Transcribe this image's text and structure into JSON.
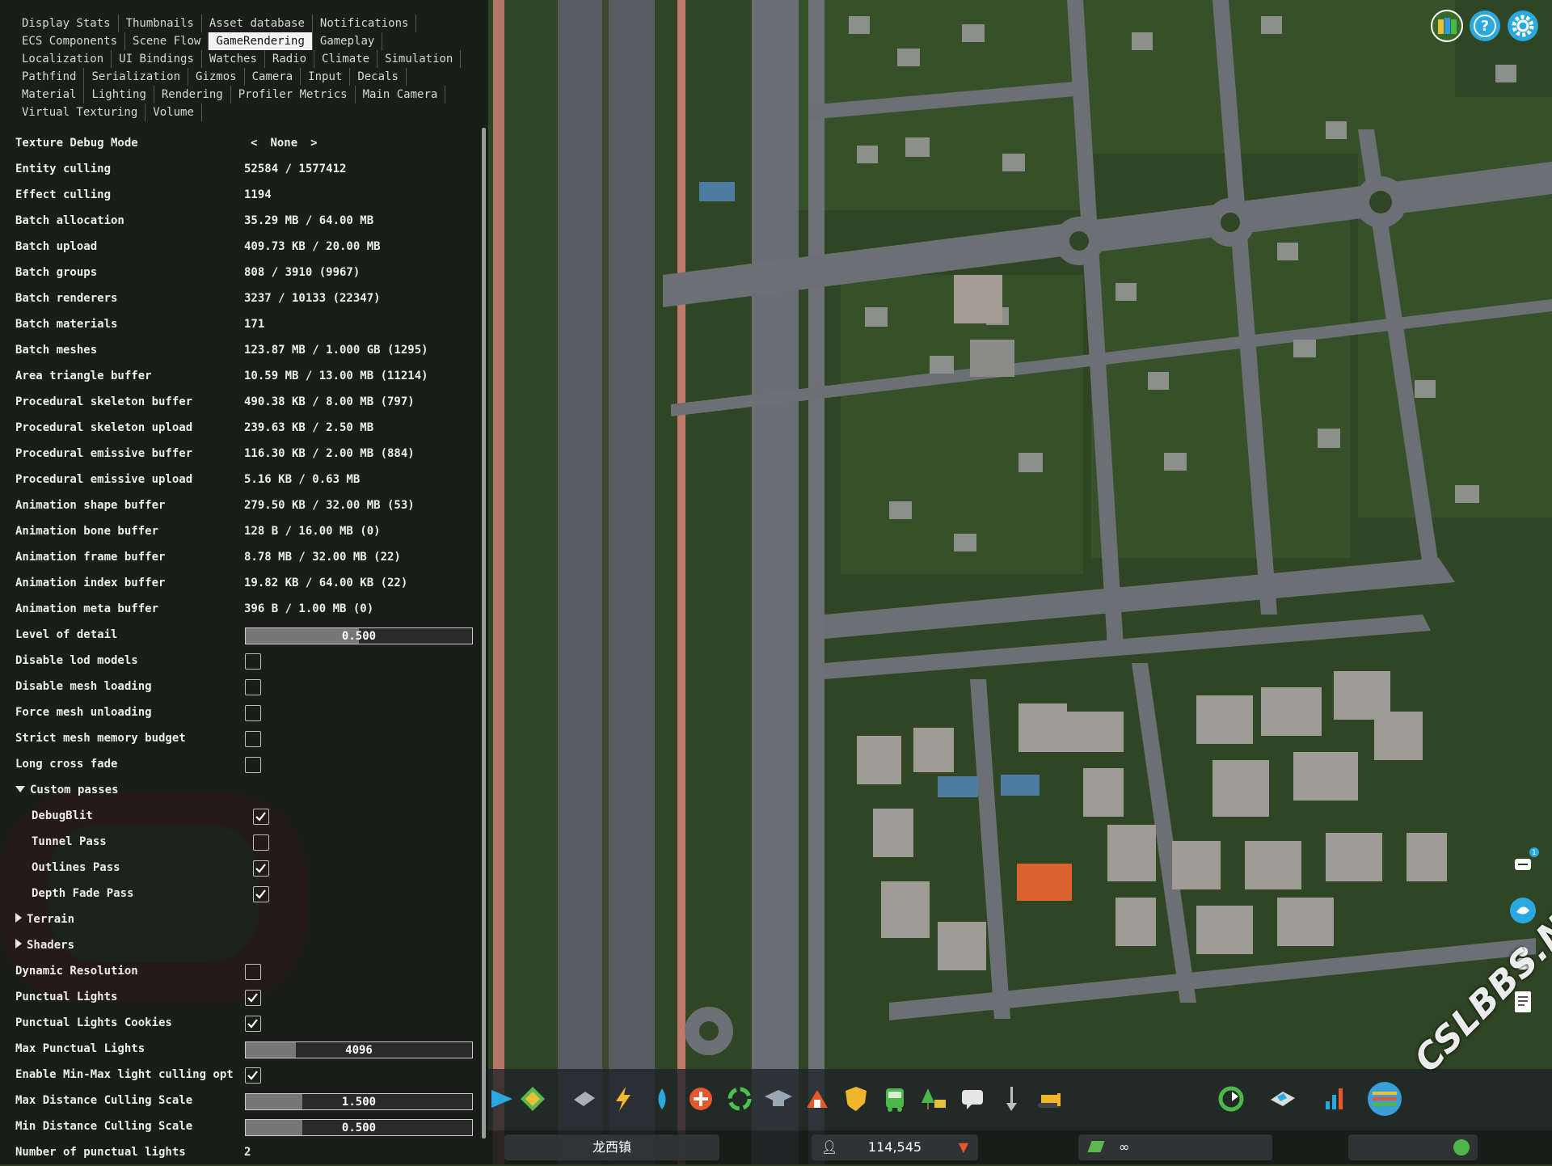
{
  "tabs": [
    [
      "Display Stats",
      "Thumbnails",
      "Asset database",
      "Notifications"
    ],
    [
      "ECS Components",
      "Scene Flow",
      "GameRendering",
      "Gameplay"
    ],
    [
      "Localization",
      "UI Bindings",
      "Watches",
      "Radio",
      "Climate",
      "Simulation"
    ],
    [
      "Pathfind",
      "Serialization",
      "Gizmos",
      "Camera",
      "Input",
      "Decals"
    ],
    [
      "Material",
      "Lighting",
      "Rendering",
      "Profiler Metrics",
      "Main Camera"
    ],
    [
      "Virtual Texturing",
      "Volume"
    ]
  ],
  "active_tab": "GameRendering",
  "texture_debug": {
    "label": "Texture Debug Mode",
    "value": "None",
    "prev": "<",
    "next": ">"
  },
  "stats": [
    {
      "label": "Entity culling",
      "value": "52584 / 1577412"
    },
    {
      "label": "Effect culling",
      "value": "1194"
    },
    {
      "label": "Batch allocation",
      "value": "35.29 MB / 64.00 MB"
    },
    {
      "label": "Batch upload",
      "value": "409.73 KB / 20.00 MB"
    },
    {
      "label": "Batch groups",
      "value": "808 / 3910 (9967)"
    },
    {
      "label": "Batch renderers",
      "value": "3237 / 10133 (22347)"
    },
    {
      "label": "Batch materials",
      "value": "171"
    },
    {
      "label": "Batch meshes",
      "value": "123.87 MB / 1.000 GB (1295)"
    },
    {
      "label": "Area triangle buffer",
      "value": "10.59 MB / 13.00 MB (11214)"
    },
    {
      "label": "Procedural skeleton buffer",
      "value": "490.38 KB / 8.00 MB (797)"
    },
    {
      "label": "Procedural skeleton upload",
      "value": "239.63 KB / 2.50 MB"
    },
    {
      "label": "Procedural emissive buffer",
      "value": "116.30 KB / 2.00 MB (884)"
    },
    {
      "label": "Procedural emissive upload",
      "value": "5.16 KB / 0.63 MB"
    },
    {
      "label": "Animation shape buffer",
      "value": "279.50 KB / 32.00 MB (53)"
    },
    {
      "label": "Animation bone buffer",
      "value": "128 B / 16.00 MB (0)"
    },
    {
      "label": "Animation frame buffer",
      "value": "8.78 MB / 32.00 MB (22)"
    },
    {
      "label": "Animation index buffer",
      "value": "19.82 KB / 64.00 KB (22)"
    },
    {
      "label": "Animation meta buffer",
      "value": "396 B / 1.00 MB (0)"
    }
  ],
  "lod": {
    "label": "Level of detail",
    "value": "0.500",
    "fraction": 0.5
  },
  "toggles1": [
    {
      "label": "Disable lod models",
      "checked": false
    },
    {
      "label": "Disable mesh loading",
      "checked": false
    },
    {
      "label": "Force mesh unloading",
      "checked": false
    },
    {
      "label": "Strict mesh memory budget",
      "checked": false
    },
    {
      "label": "Long cross fade",
      "checked": false
    }
  ],
  "custom_passes": {
    "label": "Custom passes",
    "items": [
      {
        "label": "DebugBlit",
        "checked": true
      },
      {
        "label": "Tunnel Pass",
        "checked": false
      },
      {
        "label": "Outlines Pass",
        "checked": true
      },
      {
        "label": "Depth Fade Pass",
        "checked": true
      }
    ]
  },
  "terrain": "Terrain",
  "shaders": "Shaders",
  "toggles2": [
    {
      "label": "Dynamic Resolution",
      "checked": false
    },
    {
      "label": "Punctual Lights",
      "checked": true
    },
    {
      "label": "Punctual Lights Cookies",
      "checked": true
    }
  ],
  "max_punctual": {
    "label": "Max Punctual Lights",
    "value": "4096",
    "fraction": 0.22
  },
  "minmax": {
    "label": "Enable Min-Max light culling opt",
    "checked": true
  },
  "max_dist": {
    "label": "Max Distance Culling Scale",
    "value": "1.500",
    "fraction": 0.25
  },
  "min_dist": {
    "label": "Min Distance Culling Scale",
    "value": "0.500",
    "fraction": 0.25
  },
  "num_lights": {
    "label": "Number of punctual lights",
    "value": "2"
  },
  "status": {
    "town": "龙西镇",
    "population": "114,545",
    "money": "∞"
  },
  "colors": {
    "accent": "#29a9e0",
    "road": "#707478",
    "grass": "#2f4a22",
    "rail": "#c07d6c"
  },
  "top_icons": [
    "map-icon",
    "help-icon",
    "gear-icon"
  ],
  "watermark": "CSLBBS.NET"
}
